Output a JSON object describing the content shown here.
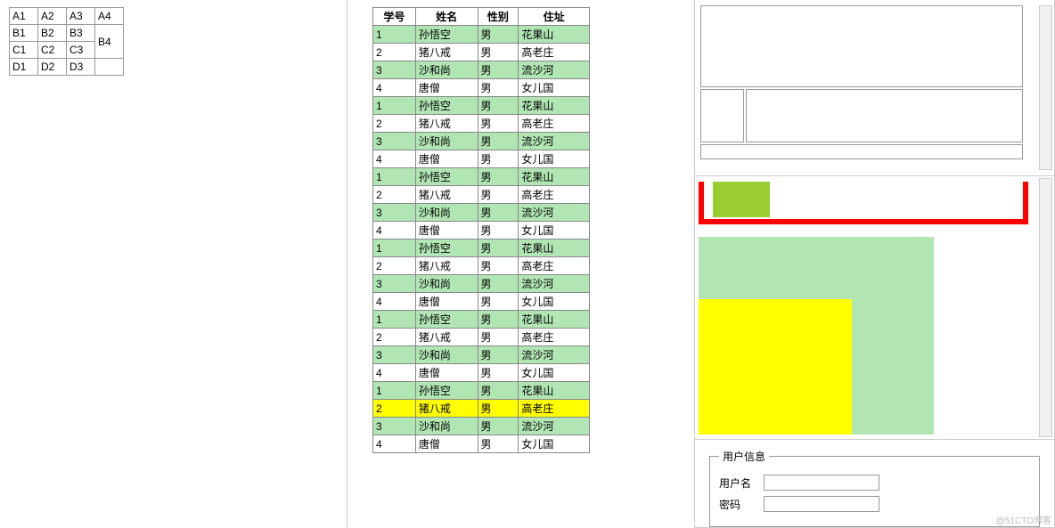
{
  "left_grid": {
    "rows": [
      [
        "A1",
        "A2",
        "A3",
        "A4"
      ],
      [
        "B1",
        "B2",
        "B3",
        ""
      ],
      [
        "C1",
        "C2",
        "C3",
        "B4"
      ],
      [
        "D1",
        "D2",
        "D3",
        ""
      ]
    ],
    "merge_B4": true
  },
  "data_table": {
    "headers": [
      "学号",
      "姓名",
      "性别",
      "住址"
    ],
    "base_rows": [
      {
        "id": "1",
        "name": "孙悟空",
        "sex": "男",
        "addr": "花果山"
      },
      {
        "id": "2",
        "name": "猪八戒",
        "sex": "男",
        "addr": "高老庄"
      },
      {
        "id": "3",
        "name": "沙和尚",
        "sex": "男",
        "addr": "流沙河"
      },
      {
        "id": "4",
        "name": "唐僧",
        "sex": "男",
        "addr": "女儿国"
      }
    ],
    "repeat": 6,
    "highlight_yellow_index": 21
  },
  "panel_b": {
    "colors": {
      "red": "#ff0000",
      "olive": "#9acd32",
      "lightgreen": "#b1e5b3",
      "yellow": "#ffff00"
    }
  },
  "panel_c": {
    "legend": "用户信息",
    "fields": [
      {
        "label": "用户名",
        "value": ""
      },
      {
        "label": "密码",
        "value": ""
      }
    ]
  },
  "watermark": "@51CTO博客"
}
